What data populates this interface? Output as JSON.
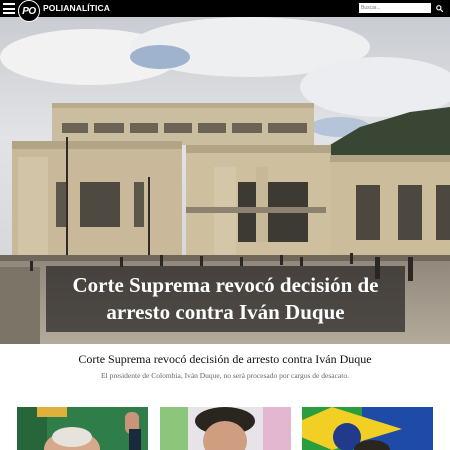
{
  "header": {
    "logo_text": "PO",
    "brand": "POLIANALÍTICA",
    "search_placeholder": "Buscar..."
  },
  "hero": {
    "headline": "Corte Suprema revocó decisión de arresto contra Iván Duque"
  },
  "article": {
    "title": "Corte Suprema revocó decisión de arresto contra Iván Duque",
    "summary": "El presidente de Colombia, Iván Duque, no será procesado por cargos de desacato."
  },
  "icons": {
    "menu": "hamburger-menu-icon",
    "search": "search-icon"
  },
  "colors": {
    "topbar": "#000000",
    "caption_overlay": "rgba(40,38,36,0.72)",
    "summary_text": "#666666"
  }
}
